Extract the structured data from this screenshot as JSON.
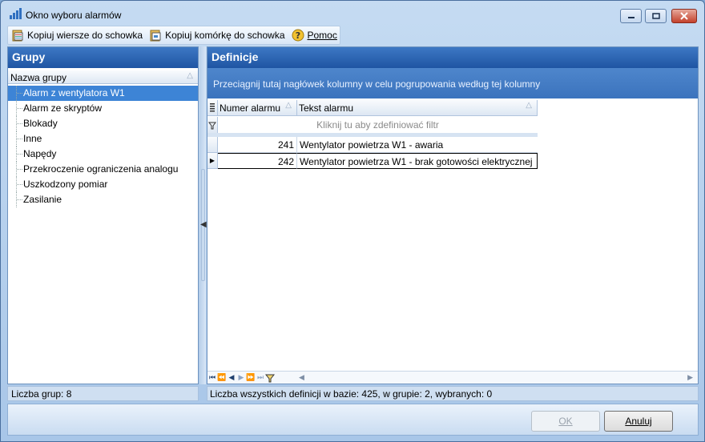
{
  "window": {
    "title": "Okno wyboru alarmów"
  },
  "toolbar": {
    "copy_rows": "Kopiuj wiersze do schowka",
    "copy_cell": "Kopiuj komórkę do schowka",
    "help": "Pomoc",
    "copy_rows_icon": "clipboard-icon",
    "copy_cell_icon": "clipboard-icon",
    "help_icon": "help-icon"
  },
  "groups": {
    "header": "Grupy",
    "column": "Nazwa grupy",
    "items": [
      "Alarm z wentylatora W1",
      "Alarm ze skryptów",
      "Blokady",
      "Inne",
      "Napędy",
      "Przekroczenie ograniczenia analogu",
      "Uszkodzony pomiar",
      "Zasilanie"
    ],
    "selected_index": 0,
    "status": "Liczba grup: 8"
  },
  "definitions": {
    "header": "Definicje",
    "group_hint": "Przeciągnij tutaj nagłówek kolumny w celu pogrupowania według tej kolumny",
    "columns": [
      "Numer alarmu",
      "Tekst alarmu"
    ],
    "filter_hint": "Kliknij tu aby zdefiniować filtr",
    "rows": [
      {
        "number": "241",
        "text": "Wentylator powietrza W1 - awaria"
      },
      {
        "number": "242",
        "text": "Wentylator powietrza W1 - brak gotowości elektrycznej"
      }
    ],
    "focused_row": 1,
    "status": "Liczba wszystkich definicji w bazie: 425, w grupie: 2, wybranych: 0"
  },
  "buttons": {
    "ok": "OK",
    "cancel": "Anuluj"
  },
  "colors": {
    "header_blue": "#1f55a3",
    "selection": "#3d84d6",
    "close_red": "#c3412c"
  }
}
